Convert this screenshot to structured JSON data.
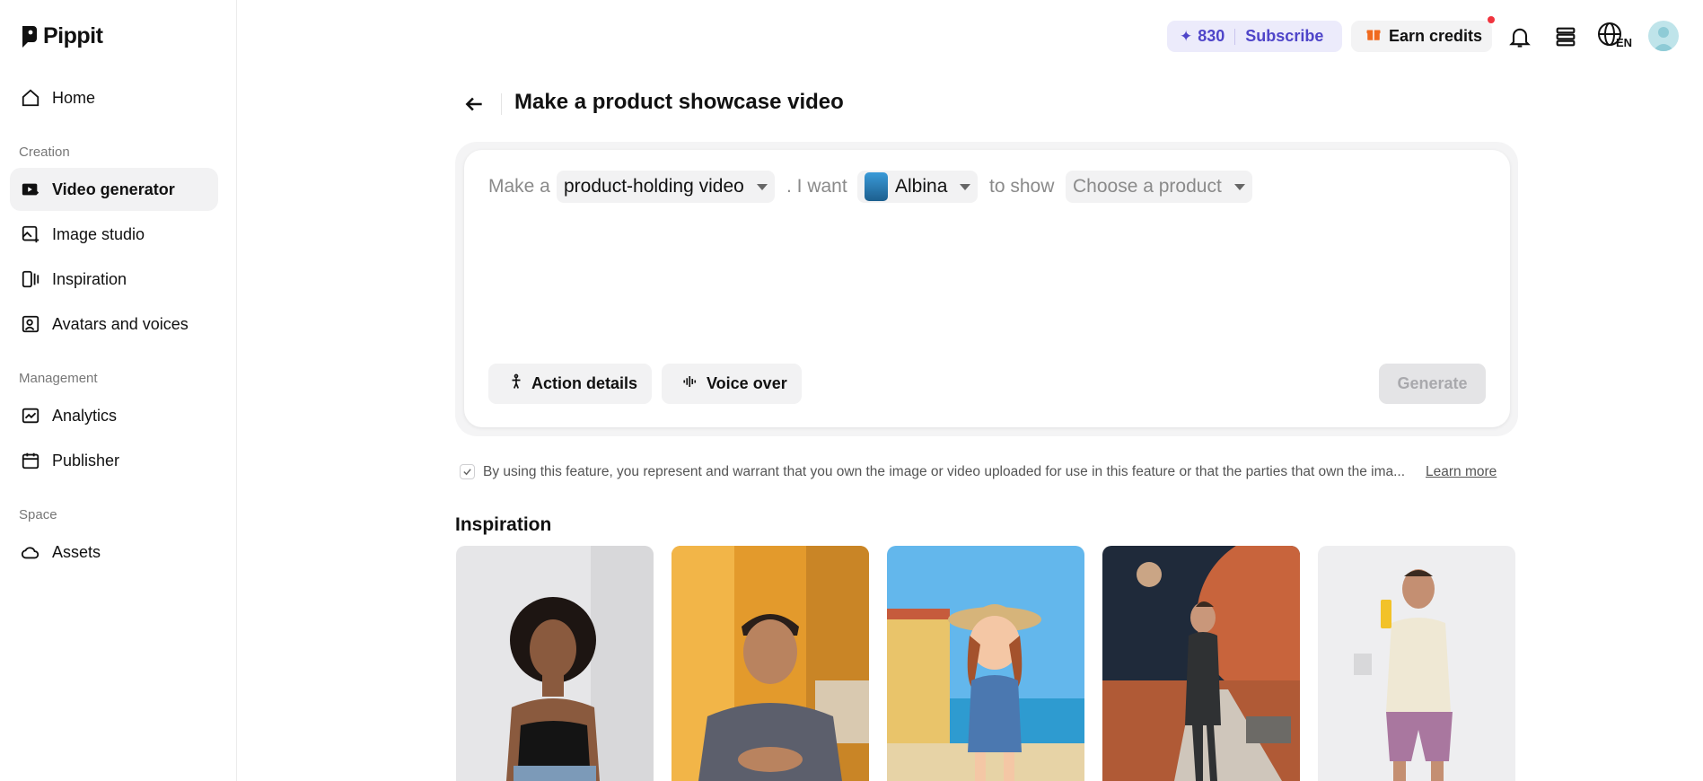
{
  "brand": {
    "name": "Pippit"
  },
  "sidebar": {
    "items_top": [
      {
        "label": "Home",
        "icon": "home-icon"
      }
    ],
    "sections": [
      {
        "title": "Creation",
        "items": [
          {
            "label": "Video generator",
            "icon": "video-generator-icon",
            "active": true
          },
          {
            "label": "Image studio",
            "icon": "image-studio-icon"
          },
          {
            "label": "Inspiration",
            "icon": "inspiration-icon"
          },
          {
            "label": "Avatars and voices",
            "icon": "avatar-voice-icon"
          }
        ]
      },
      {
        "title": "Management",
        "items": [
          {
            "label": "Analytics",
            "icon": "analytics-icon"
          },
          {
            "label": "Publisher",
            "icon": "calendar-icon"
          }
        ]
      },
      {
        "title": "Space",
        "items": [
          {
            "label": "Assets",
            "icon": "cloud-icon"
          }
        ]
      }
    ]
  },
  "header": {
    "credits": "830",
    "subscribe_label": "Subscribe",
    "earn_label": "Earn credits",
    "language": "EN",
    "accent_color": "#4f45c9",
    "notification_color": "#f0343e"
  },
  "page": {
    "title": "Make a product showcase video"
  },
  "prompt": {
    "text_make": "Make a",
    "video_type": "product-holding video",
    "text_iwant": ". I want",
    "avatar_name": "Albina",
    "text_toshow": "to show",
    "product_placeholder": "Choose a product"
  },
  "actions": {
    "action_details": "Action details",
    "voice_over": "Voice over",
    "generate": "Generate"
  },
  "disclaimer": {
    "text": "By using this feature, you represent and warrant that you own the image or video uploaded for use in this feature or that the parties that own the ima...",
    "link": "Learn more"
  },
  "inspiration": {
    "title": "Inspiration",
    "cards": [
      {
        "subject": "woman-black-top"
      },
      {
        "subject": "man-talking"
      },
      {
        "subject": "cartoon-girl-beach"
      },
      {
        "subject": "man-suit-mars"
      },
      {
        "subject": "man-holding-product"
      }
    ]
  }
}
